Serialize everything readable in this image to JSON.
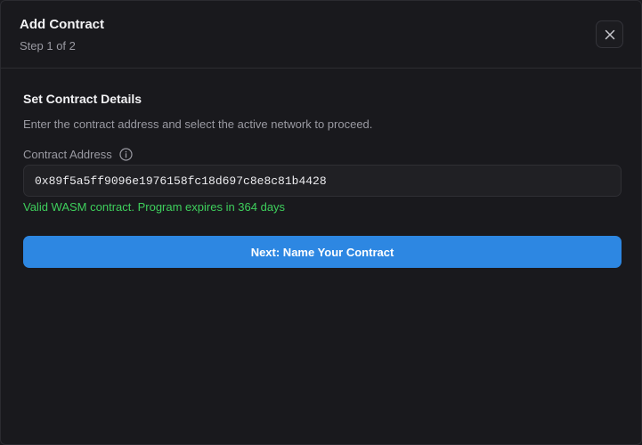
{
  "modal": {
    "title": "Add Contract",
    "step": "Step 1 of 2",
    "close_icon": "close-icon"
  },
  "section": {
    "title": "Set Contract Details",
    "description": "Enter the contract address and select the active network to proceed."
  },
  "contract_address": {
    "label": "Contract Address",
    "info_icon": "info-icon",
    "value": "0x89f5a5ff9096e1976158fc18d697c8e8c81b4428",
    "validation": "Valid WASM contract. Program expires in 364 days"
  },
  "next_button": {
    "label": "Next: Name Your Contract"
  },
  "colors": {
    "background": "#19191d",
    "accent": "#2d87e2",
    "success": "#3ecf5c",
    "muted_text": "#9a9aa2"
  }
}
